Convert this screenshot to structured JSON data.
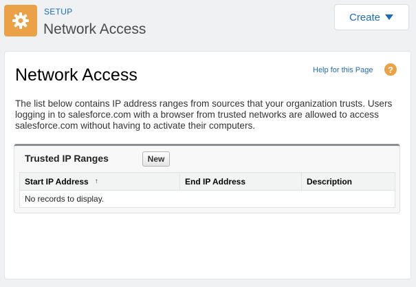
{
  "header": {
    "icon": "gear-icon",
    "breadcrumb": "SETUP",
    "title": "Network Access",
    "create_label": "Create",
    "create_icon": "caret-down-icon"
  },
  "content": {
    "title": "Network Access",
    "help_link": "Help for this Page",
    "help_icon": "question-icon",
    "help_icon_glyph": "?",
    "description": "The list below contains IP address ranges from sources that your organization trusts. Users logging in to salesforce.com with a browser from trusted networks are allowed to access salesforce.com without having to activate their computers."
  },
  "trusted_ranges": {
    "title": "Trusted IP Ranges",
    "new_label": "New",
    "columns": [
      {
        "label": "Start IP Address",
        "sort": "↑"
      },
      {
        "label": "End IP Address"
      },
      {
        "label": "Description"
      }
    ],
    "empty_message": "No records to display."
  },
  "colors": {
    "accent": "#1c6bb8",
    "brand_icon": "#eba146"
  }
}
